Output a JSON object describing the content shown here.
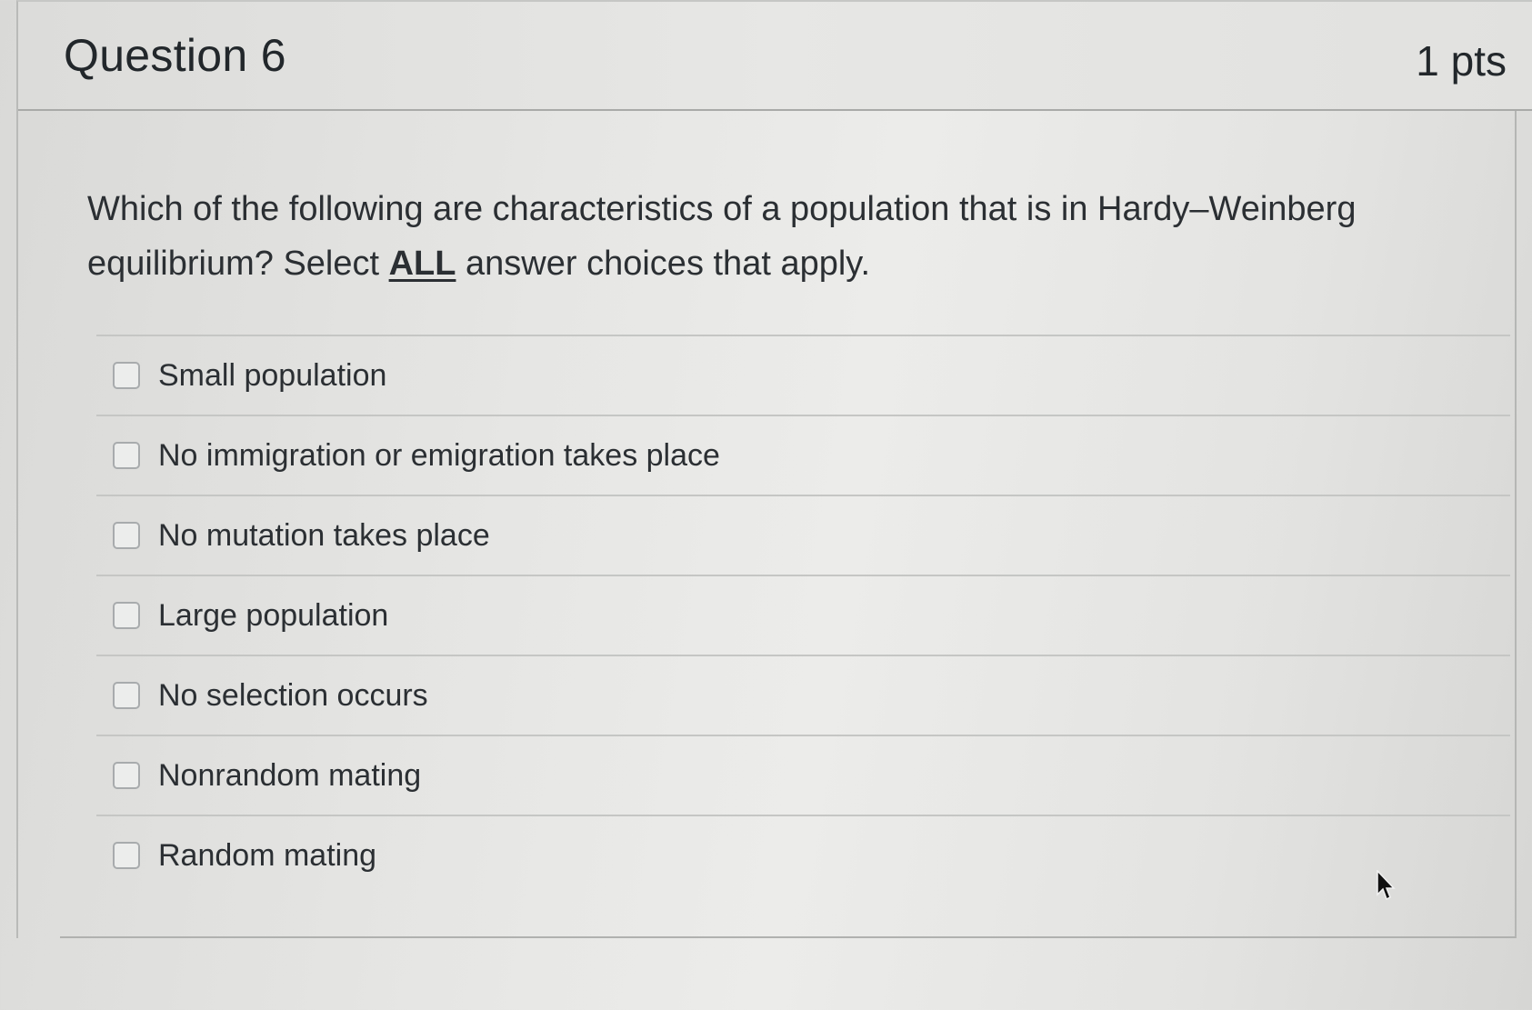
{
  "question": {
    "title": "Question 6",
    "points": "1 pts",
    "text_part1": "Which of the following are characteristics of a population that is in Hardy–Weinberg equilibrium? Select ",
    "text_emphasis": "ALL",
    "text_part2": " answer choices that apply."
  },
  "answers": [
    {
      "label": "Small population",
      "checked": false
    },
    {
      "label": "No immigration or emigration takes place",
      "checked": false
    },
    {
      "label": "No mutation takes place",
      "checked": false
    },
    {
      "label": "Large population",
      "checked": false
    },
    {
      "label": "No selection occurs",
      "checked": false
    },
    {
      "label": "Nonrandom mating",
      "checked": false
    },
    {
      "label": "Random mating",
      "checked": false
    }
  ],
  "icons": {
    "cursor": "mouse-pointer-icon"
  }
}
